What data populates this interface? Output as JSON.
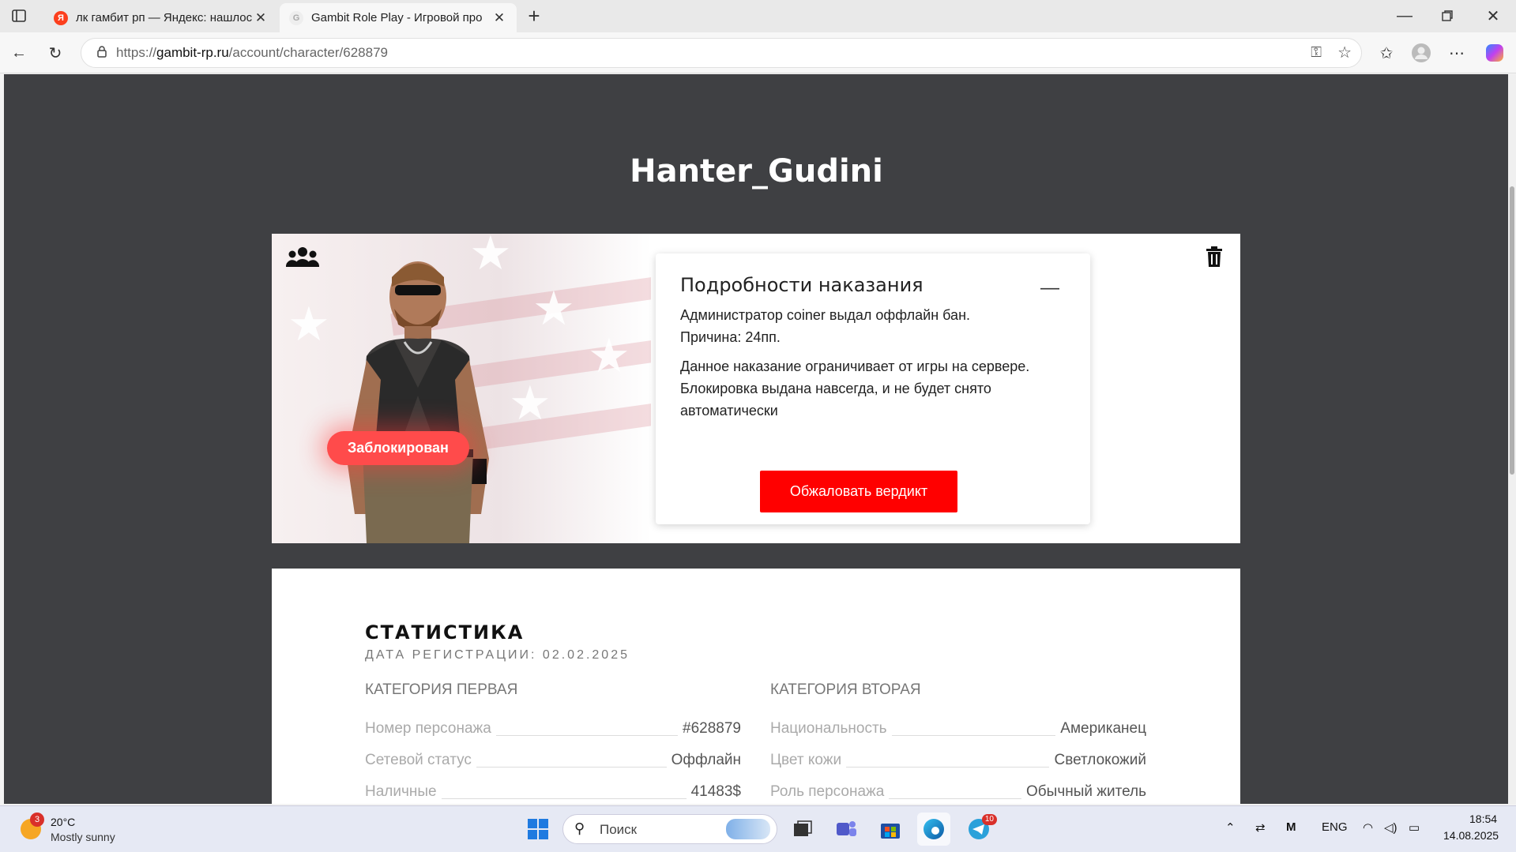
{
  "browser": {
    "tabs": [
      {
        "title": "лк гамбит рп — Яндекс: нашлос",
        "active": false
      },
      {
        "title": "Gambit Role Play - Игровой про",
        "active": true
      }
    ],
    "url_prefix": "https://",
    "url_domain": "gambit-rp.ru",
    "url_path": "/account/character/628879"
  },
  "page": {
    "character_name": "Hanter_Gudini",
    "status_badge": "Заблокирован",
    "punishment": {
      "title": "Подробности наказания",
      "line1": "Администратор coiner выдал оффлайн бан.",
      "line2": "Причина: 24пп.",
      "description": "Данное наказание ограничивает от игры на сервере. Блокировка выдана навсегда, и не будет снято автоматически",
      "appeal_button": "Обжаловать вердикт"
    },
    "stats": {
      "title": "СТАТИСТИКА",
      "registration": "ДАТА РЕГИСТРАЦИИ: 02.02.2025",
      "category1": {
        "title": "КАТЕГОРИЯ ПЕРВАЯ",
        "rows": [
          {
            "label": "Номер персонажа",
            "value": "#628879"
          },
          {
            "label": "Сетевой статус",
            "value": "Оффлайн"
          },
          {
            "label": "Наличные",
            "value": "41483$"
          }
        ]
      },
      "category2": {
        "title": "КАТЕГОРИЯ ВТОРАЯ",
        "rows": [
          {
            "label": "Национальность",
            "value": "Американец"
          },
          {
            "label": "Цвет кожи",
            "value": "Светлокожий"
          },
          {
            "label": "Роль персонажа",
            "value": "Обычный житель"
          }
        ]
      }
    }
  },
  "taskbar": {
    "weather_temp": "20°C",
    "weather_desc": "Mostly sunny",
    "weather_badge": "3",
    "search_placeholder": "Поиск",
    "telegram_badge": "10",
    "lang": "ENG",
    "time": "18:54",
    "date": "14.08.2025"
  },
  "colors": {
    "page_bg": "#3f4043",
    "badge_red": "#ff4b4b",
    "appeal_red": "#ff0000"
  }
}
